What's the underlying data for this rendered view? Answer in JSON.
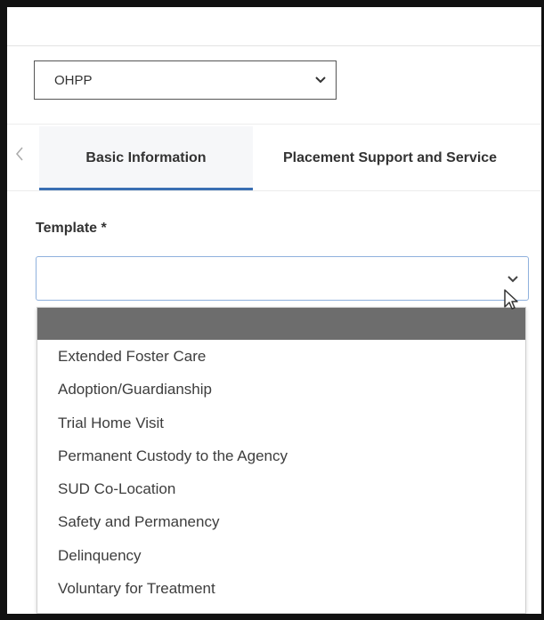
{
  "agency_select": {
    "value": "OHPP"
  },
  "tabs": [
    {
      "label": "Basic Information",
      "active": true
    },
    {
      "label": "Placement Support and Service"
    }
  ],
  "template_field": {
    "label": "Template *",
    "value": "",
    "options": [
      "",
      "Extended Foster Care",
      "Adoption/Guardianship",
      "Trial Home Visit",
      "Permanent Custody to the Agency",
      "SUD Co-Location",
      "Safety and Permanency",
      "Delinquency",
      "Voluntary for Treatment"
    ]
  },
  "icons": {
    "agency_chevron": "chevron-down-icon",
    "tabs_prev": "chevron-left-icon",
    "template_chevron": "chevron-down-icon",
    "cursor": "mouse-pointer-icon"
  },
  "colors": {
    "active_tab_underline": "#3a6fb3",
    "focused_border": "#8fb1dd",
    "highlighted_option": "#6d6d6d"
  }
}
